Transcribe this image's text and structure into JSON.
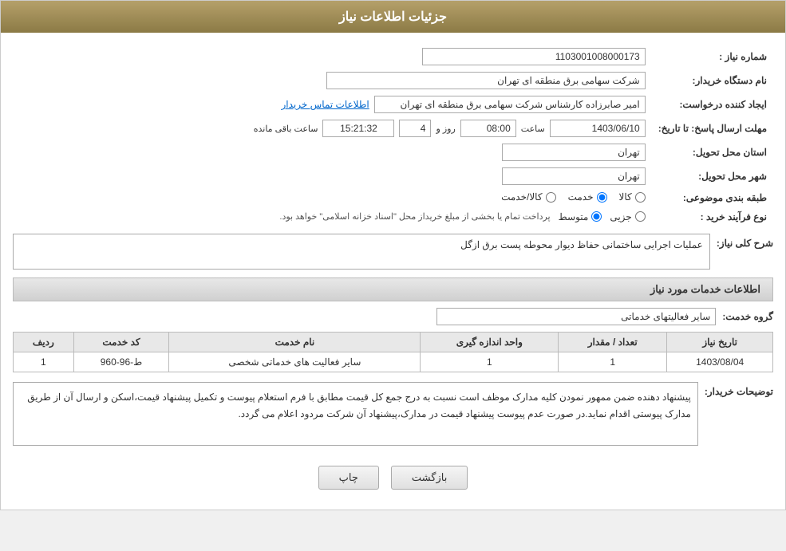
{
  "header": {
    "title": "جزئیات اطلاعات نیاز"
  },
  "fields": {
    "shomareNiaz_label": "شماره نیاز :",
    "shomareNiaz_value": "1103001008000173",
    "namDastgah_label": "نام دستگاه خریدار:",
    "namDastgah_value": "شرکت سهامی برق منطقه ای تهران",
    "ijadKonande_label": "ایجاد کننده درخواست:",
    "ijadKonande_value": "امیر صابرزاده کارشناس شرکت سهامی برق منطقه ای تهران",
    "etelaatTamas_label": "اطلاعات تماس خریدار",
    "mohlatErsal_label": "مهلت ارسال پاسخ: تا تاریخ:",
    "tarikh_value": "1403/06/10",
    "saat_label": "ساعت",
    "saat_value": "08:00",
    "rooz_label": "روز و",
    "rooz_value": "4",
    "countdown_value": "15:21:32",
    "countdown_label": "ساعت باقی مانده",
    "ostan_label": "استان محل تحویل:",
    "ostan_value": "تهران",
    "shahr_label": "شهر محل تحویل:",
    "shahr_value": "تهران",
    "tabaqeBandi_label": "طبقه بندی موضوعی:",
    "tabaqe_kala": "کالا",
    "tabaqe_khadamat": "خدمت",
    "tabaqe_kala_khadamat": "کالا/خدمت",
    "noefarayand_label": "نوع فرآیند خرید :",
    "noefarayand_jozii": "جزیی",
    "noefarayand_motevaset": "متوسط",
    "noefarayand_desc": "پرداخت تمام یا بخشی از مبلغ خریداز محل \"اسناد خزانه اسلامی\" خواهد بود.",
    "sharhNiaz_label": "شرح کلی نیاز:",
    "sharhNiaz_value": "عملیات اجرایی ساختمانی حفاظ دیوار محوطه پست برق ازگل",
    "ettela_khadamat_label": "اطلاعات خدمات مورد نیاز",
    "groheKhadamat_label": "گروه خدمت:",
    "groheKhadamat_value": "سایر فعالیتهای خدماتی",
    "table_headers": {
      "radif": "ردیف",
      "code": "کد خدمت",
      "name": "نام خدمت",
      "vahed": "واحد اندازه گیری",
      "tedad": "تعداد / مقدار",
      "tarikh": "تاریخ نیاز"
    },
    "table_rows": [
      {
        "radif": "1",
        "code": "ط-96-960",
        "name": "سایر فعالیت های خدماتی شخصی",
        "vahed": "1",
        "tedad": "1",
        "tarikh": "1403/08/04"
      }
    ],
    "toshihat_label": "توضیحات خریدار:",
    "toshihat_value": "پیشنهاد دهنده ضمن ممهور نمودن کلیه مدارک موظف است نسبت به درج جمع کل قیمت مطابق با فرم استعلام پیوست و تکمیل پیشنهاد قیمت،اسکن و ارسال آن از طریق مدارک پیوستی اقدام نماید.در صورت عدم پیوست پیشنهاد قیمت در مدارک،پیشنهاد آن شرکت مردود اعلام می گردد.",
    "btn_back": "بازگشت",
    "btn_print": "چاپ"
  }
}
